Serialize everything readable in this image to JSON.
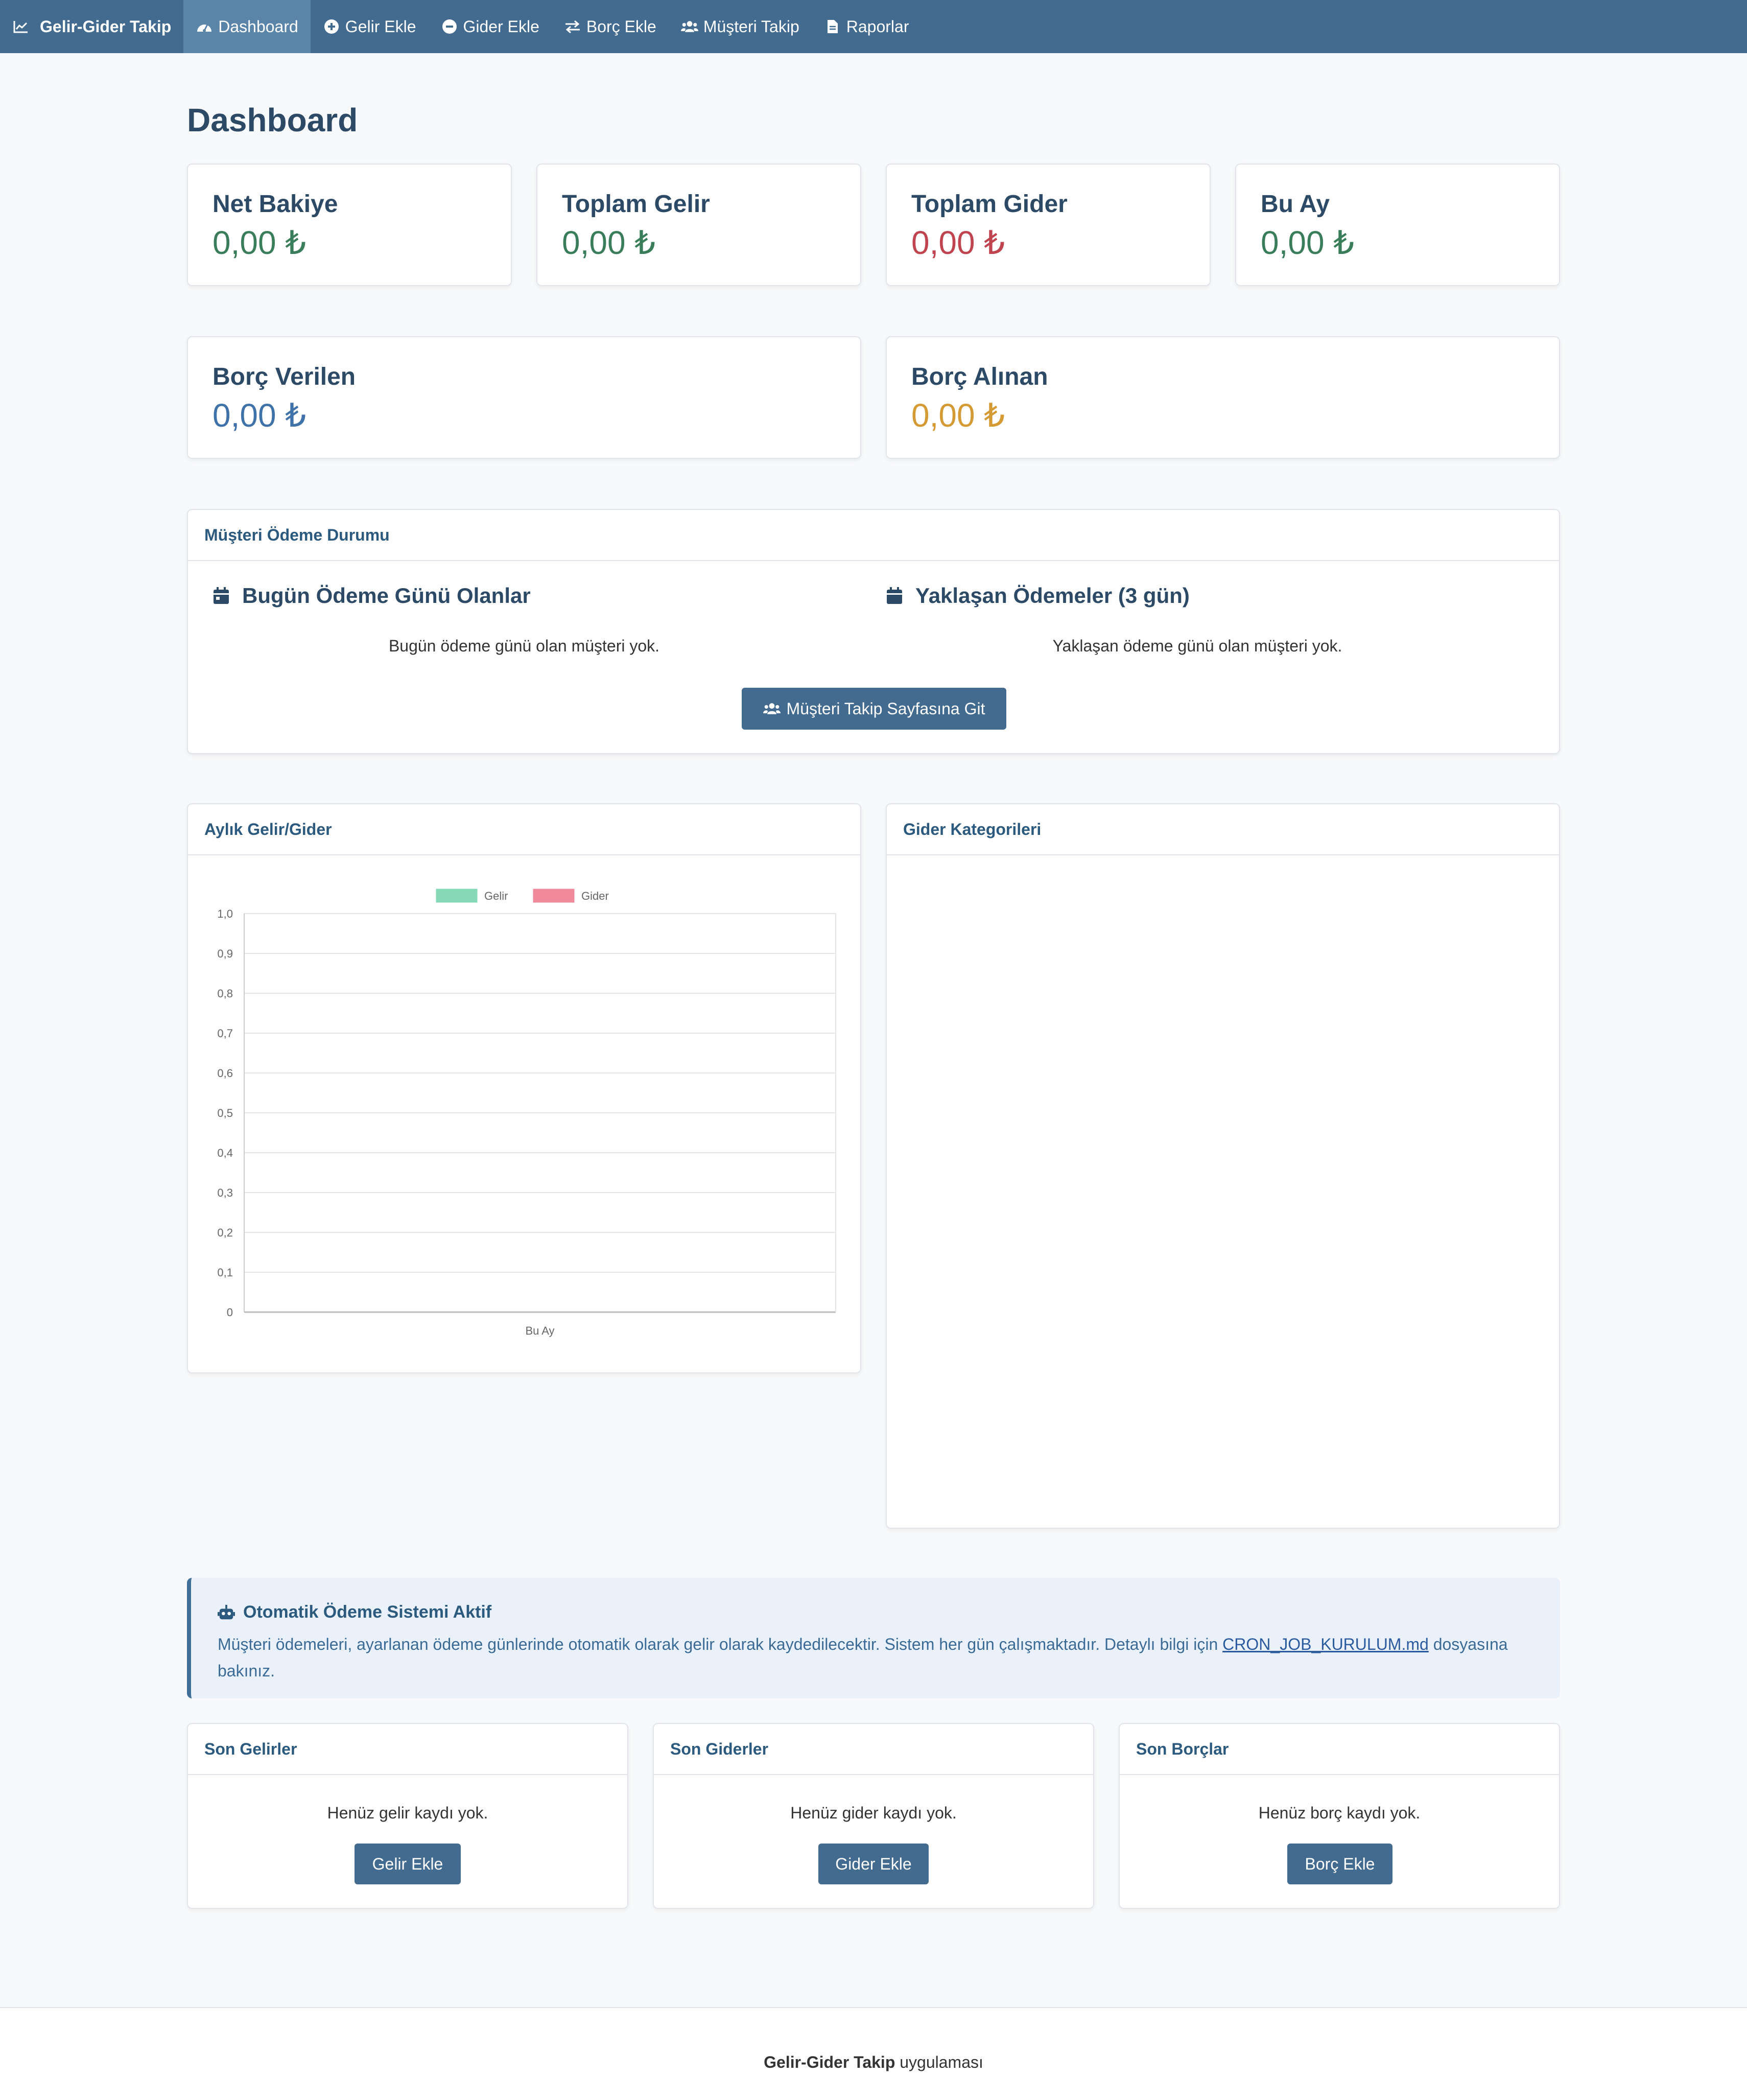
{
  "navbar": {
    "brand": "Gelir-Gider Takip",
    "items": [
      {
        "label": "Dashboard",
        "icon": "tachometer-icon"
      },
      {
        "label": "Gelir Ekle",
        "icon": "plus-circle-icon"
      },
      {
        "label": "Gider Ekle",
        "icon": "minus-circle-icon"
      },
      {
        "label": "Borç Ekle",
        "icon": "exchange-icon"
      },
      {
        "label": "Müşteri Takip",
        "icon": "users-icon"
      },
      {
        "label": "Raporlar",
        "icon": "file-icon"
      }
    ]
  },
  "page_title": "Dashboard",
  "stats": {
    "net_bakiye": {
      "label": "Net Bakiye",
      "value": "0,00 ₺"
    },
    "toplam_gelir": {
      "label": "Toplam Gelir",
      "value": "0,00 ₺"
    },
    "toplam_gider": {
      "label": "Toplam Gider",
      "value": "0,00 ₺"
    },
    "bu_ay": {
      "label": "Bu Ay",
      "value": "0,00 ₺"
    },
    "borc_verilen": {
      "label": "Borç Verilen",
      "value": "0,00 ₺"
    },
    "borc_alinan": {
      "label": "Borç Alınan",
      "value": "0,00 ₺"
    }
  },
  "colors": {
    "navbar": "#436b8f",
    "positive": "#3a7d5a",
    "negative": "#c0444f",
    "blue": "#3f72a8",
    "orange": "#d49a34"
  },
  "musteri_odeme": {
    "header": "Müşteri Ödeme Durumu",
    "today_title": "Bugün Ödeme Günü Olanlar",
    "today_empty": "Bugün ödeme günü olan müşteri yok.",
    "upcoming_title": "Yaklaşan Ödemeler (3 gün)",
    "upcoming_empty": "Yaklaşan ödeme günü olan müşteri yok.",
    "button": "Müşteri Takip Sayfasına Git"
  },
  "charts": {
    "monthly_header": "Aylık Gelir/Gider",
    "category_header": "Gider Kategorileri"
  },
  "chart_data": {
    "type": "bar",
    "categories": [
      "Bu Ay"
    ],
    "series": [
      {
        "name": "Gelir",
        "values": [
          0
        ],
        "color": "#86d9b6"
      },
      {
        "name": "Gider",
        "values": [
          0
        ],
        "color": "#f08a9b"
      }
    ],
    "yticks": [
      "0",
      "0,1",
      "0,2",
      "0,3",
      "0,4",
      "0,5",
      "0,6",
      "0,7",
      "0,8",
      "0,9",
      "1,0"
    ],
    "ylim": [
      0,
      1
    ],
    "grid": true,
    "legend": "top"
  },
  "alert": {
    "title": "Otomatik Ödeme Sistemi Aktif",
    "text_before": "Müşteri ödemeleri, ayarlanan ödeme günlerinde otomatik olarak gelir olarak kaydedilecektir. Sistem her gün çalışmaktadır. Detaylı bilgi için ",
    "link": "CRON_JOB_KURULUM.md",
    "text_after": " dosyasına bakınız."
  },
  "recent": {
    "gelirler": {
      "header": "Son Gelirler",
      "empty": "Henüz gelir kaydı yok.",
      "button": "Gelir Ekle"
    },
    "giderler": {
      "header": "Son Giderler",
      "empty": "Henüz gider kaydı yok.",
      "button": "Gider Ekle"
    },
    "borclar": {
      "header": "Son Borçlar",
      "empty": "Henüz borç kaydı yok.",
      "button": "Borç Ekle"
    }
  },
  "footer": {
    "brand": "Gelir-Gider Takip",
    "suffix": " uygulaması"
  }
}
